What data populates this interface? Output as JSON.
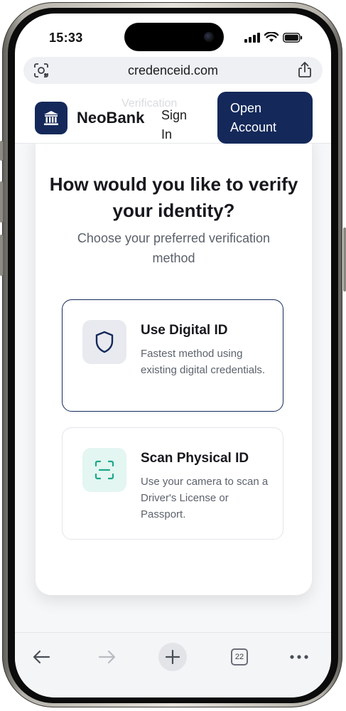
{
  "status_bar": {
    "time": "15:33"
  },
  "browser": {
    "url": "credenceid.com",
    "tabs_count": "22"
  },
  "header": {
    "brand": "NeoBank",
    "sign_in": "Sign In",
    "open_account": "Open Account",
    "ghost_text": "Verification"
  },
  "verify": {
    "heading": "How would you like to verify your identity?",
    "subheading": "Choose your preferred verification method",
    "options": [
      {
        "title": "Use Digital ID",
        "description": "Fastest method using existing digital credentials.",
        "icon": "shield-icon",
        "selected": true
      },
      {
        "title": "Scan Physical ID",
        "description": "Use your camera to scan a Driver's License or Passport.",
        "icon": "scan-icon",
        "selected": false
      }
    ]
  },
  "icons": {
    "url_left": "camera-lens-icon",
    "url_right": "share-icon",
    "logo": "bank-icon",
    "nav": [
      "back-arrow-icon",
      "forward-arrow-icon",
      "plus-icon",
      "tabs-icon",
      "more-icon"
    ]
  },
  "colors": {
    "brand_navy": "#14295a",
    "scan_green": "#1ea88a",
    "scan_bg": "#e3f6f1",
    "shield_bg": "#e8eaef"
  }
}
